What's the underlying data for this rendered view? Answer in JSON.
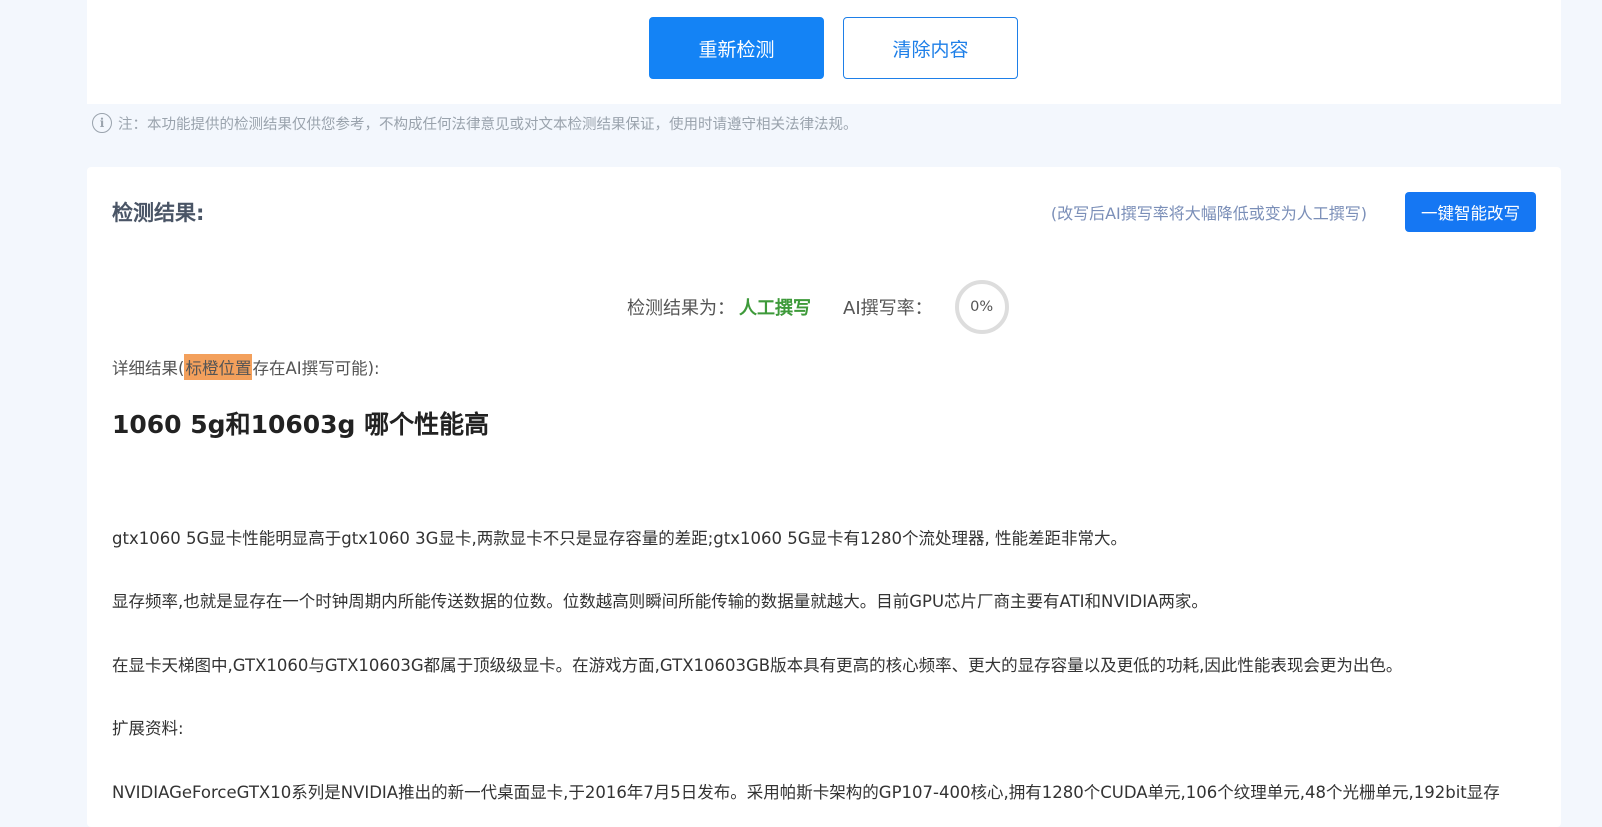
{
  "top": {
    "recheck_label": "重新检测",
    "clear_label": "清除内容",
    "notice_icon": "i",
    "notice": "注：本功能提供的检测结果仅供您参考，不构成任何法律意见或对文本检测结果保证，使用时请遵守相关法律法规。"
  },
  "result": {
    "title": "检测结果:",
    "rewrite_hint": "(改写后AI撰写率将大幅降低或变为人工撰写)",
    "rewrite_button": "一键智能改写",
    "summary_label": "检测结果为：",
    "summary_value": "人工撰写",
    "rate_label": "AI撰写率：",
    "rate_value": "0%",
    "detail_prefix": "详细结果(",
    "detail_highlight": "标橙位置",
    "detail_suffix": "存在AI撰写可能):"
  },
  "article": {
    "title": "1060 5g和10603g 哪个性能高",
    "paragraphs": [
      "gtx1060 5G显卡性能明显高于gtx1060 3G显卡,两款显卡不只是显存容量的差距;gtx1060 5G显卡有1280个流处理器, 性能差距非常大。",
      "显存频率,也就是显存在一个时钟周期内所能传送数据的位数。位数越高则瞬间所能传输的数据量就越大。目前GPU芯片厂商主要有ATI和NVIDIA两家。",
      "在显卡天梯图中,GTX1060与GTX10603G都属于顶级级显卡。在游戏方面,GTX10603GB版本具有更高的核心频率、更大的显存容量以及更低的功耗,因此性能表现会更为出色。",
      "扩展资料:",
      "NVIDIAGeForceGTX10系列是NVIDIA推出的新一代桌面显卡,于2016年7月5日发布。采用帕斯卡架构的GP107-400核心,拥有1280个CUDA单元,106个纹理单元,48个光栅单元,192bit显存"
    ]
  },
  "colors": {
    "primary": "#1483f5",
    "human_green": "#3e9a3a",
    "highlight_orange": "#f3a05c"
  }
}
